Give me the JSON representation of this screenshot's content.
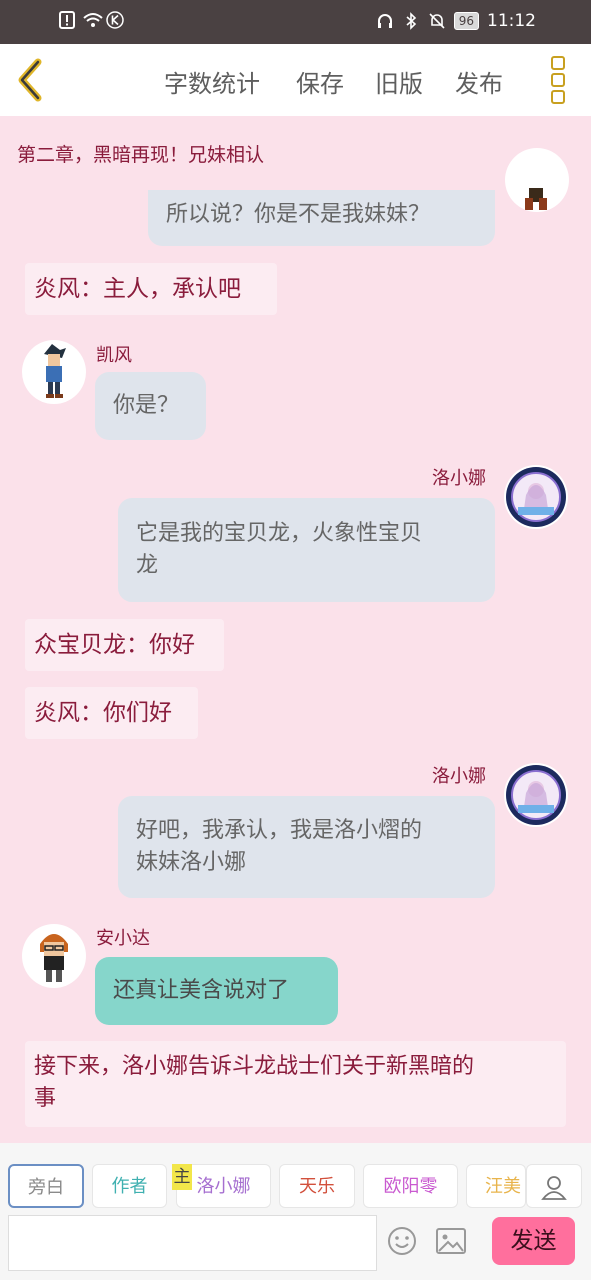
{
  "status_bar": {
    "battery": "96",
    "time": "11:12"
  },
  "header": {
    "back_icon": "chevron-left-icon",
    "menu": [
      "字数统计",
      "保存",
      "旧版",
      "发布"
    ],
    "more_icon": "more-vertical-icon"
  },
  "chapter_title": "第二章，黑暗再现！兄妹相认",
  "messages": {
    "m1": {
      "text": "所以说？你是不是我妹妹？"
    },
    "m2": {
      "text": "炎风：主人，承认吧"
    },
    "m3": {
      "name": "凯风",
      "text": "你是？"
    },
    "m4": {
      "name": "洛小娜",
      "line1": "它是我的宝贝龙，火象性宝贝",
      "line2": "龙"
    },
    "m5": {
      "text": "众宝贝龙：你好"
    },
    "m6": {
      "text": "炎风：你们好"
    },
    "m7": {
      "name": "洛小娜",
      "line1": "好吧，我承认，我是洛小熠的",
      "line2": "妹妹洛小娜"
    },
    "m8": {
      "name": "安小达",
      "text": "还真让美含说对了"
    },
    "m9": {
      "line1": "接下来，洛小娜告诉斗龙战士们关于新黑暗的",
      "line2": "事"
    }
  },
  "characters": {
    "chips": [
      "旁白",
      "作者",
      "洛小娜",
      "天乐",
      "欧阳零",
      "汪美"
    ],
    "main_badge": "主",
    "colors": {
      "旁白": "#8a8a8a",
      "作者": "#3fb0b0",
      "洛小娜": "#a66fd0",
      "天乐": "#d2503c",
      "欧阳零": "#c95ad0",
      "汪美": "#e8b44c"
    },
    "profile_icon": "person-icon"
  },
  "composer": {
    "input_value": "",
    "emoji_icon": "emoji-icon",
    "image_icon": "image-icon",
    "send_label": "发送"
  },
  "colors": {
    "background": "#fbe1ea",
    "narration_text": "#8a1c3c",
    "bubble_gray": "#dfe4ec",
    "bubble_teal": "#86d6cb",
    "send_button": "#ff6f9d"
  }
}
